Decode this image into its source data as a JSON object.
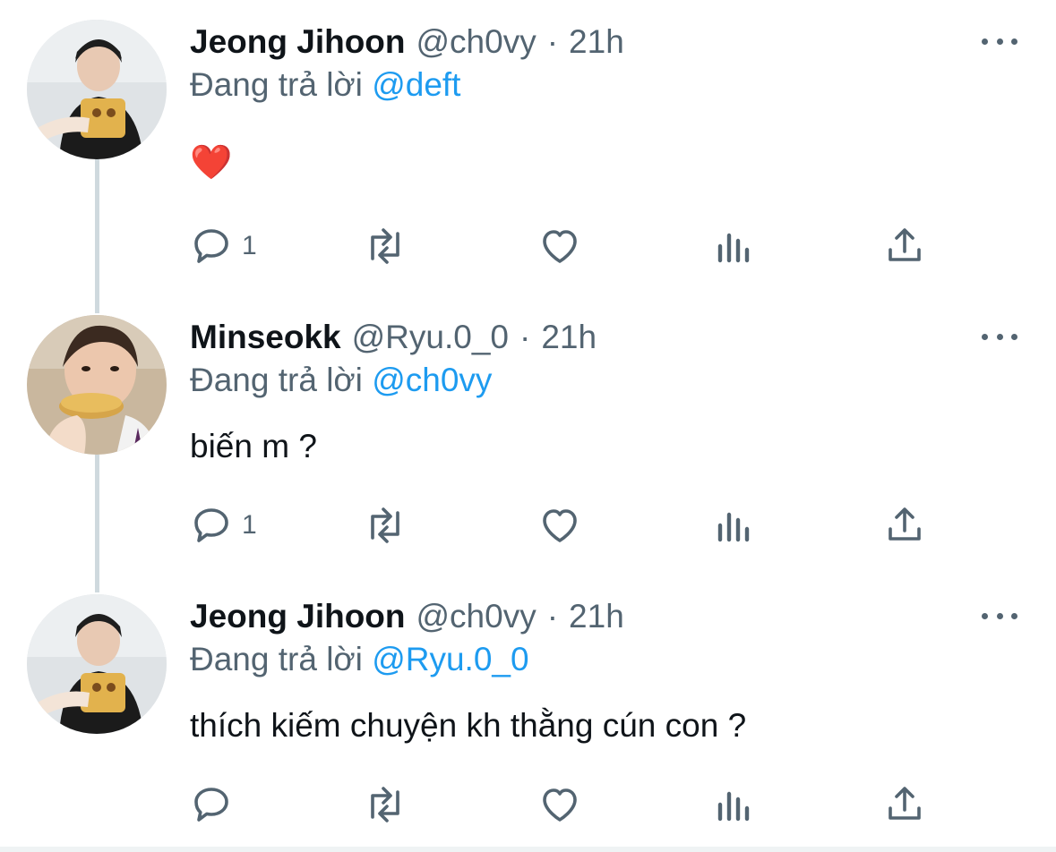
{
  "replying_prefix": "Đang trả lời",
  "colors": {
    "link": "#1d9bf0",
    "muted": "#536471",
    "text": "#0f1419",
    "thread_line": "#cfd9de"
  },
  "tweets": [
    {
      "author_name": "Jeong Jihoon",
      "handle": "@ch0vy",
      "separator": "·",
      "time": "21h",
      "replying_to": "@deft",
      "text": "❤️",
      "reply_count": "1",
      "avatar": "avatar-jeong-jihoon"
    },
    {
      "author_name": "Minseokk",
      "handle": "@Ryu.0_0",
      "separator": "·",
      "time": "21h",
      "replying_to": "@ch0vy",
      "text": "biến m ?",
      "reply_count": "1",
      "avatar": "avatar-minseokk"
    },
    {
      "author_name": "Jeong Jihoon",
      "handle": "@ch0vy",
      "separator": "·",
      "time": "21h",
      "replying_to": "@Ryu.0_0",
      "text": "thích kiếm chuyện kh thằng cún con ?",
      "reply_count": "",
      "avatar": "avatar-jeong-jihoon"
    }
  ],
  "icons": {
    "reply": "speech-bubble-icon",
    "retweet": "retweet-icon",
    "like": "heart-icon",
    "views": "bar-chart-icon",
    "share": "share-upload-icon",
    "more": "more-dots-icon"
  }
}
